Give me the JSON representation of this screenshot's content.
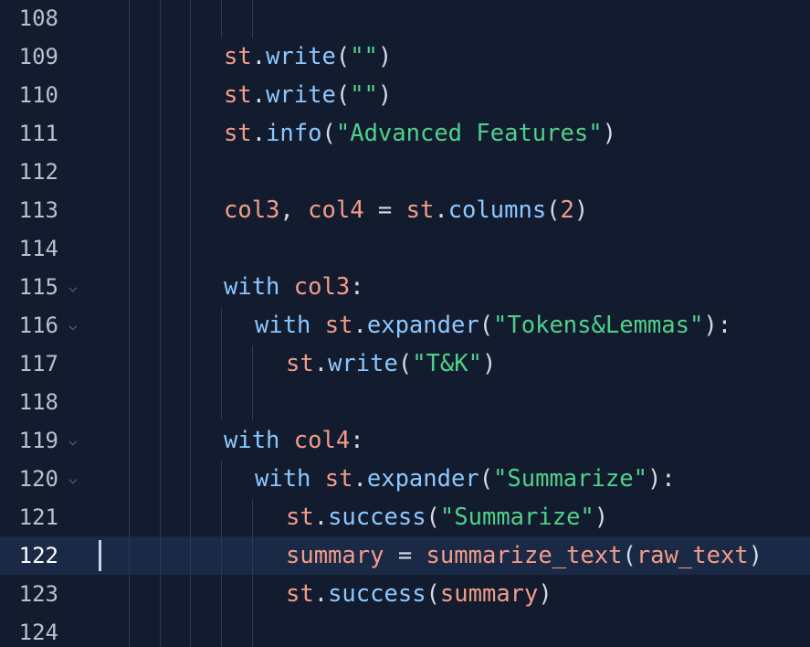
{
  "editor": {
    "lines": [
      {
        "num": "108",
        "fold": false,
        "active": false,
        "indent": 0,
        "tokens": []
      },
      {
        "num": "109",
        "fold": false,
        "active": false,
        "indent": 1,
        "tokens": [
          {
            "t": "st",
            "c": "var"
          },
          {
            "t": ".",
            "c": "op"
          },
          {
            "t": "write",
            "c": "fn"
          },
          {
            "t": "(",
            "c": "op"
          },
          {
            "t": "\"\"",
            "c": "str"
          },
          {
            "t": ")",
            "c": "op"
          }
        ]
      },
      {
        "num": "110",
        "fold": false,
        "active": false,
        "indent": 1,
        "tokens": [
          {
            "t": "st",
            "c": "var"
          },
          {
            "t": ".",
            "c": "op"
          },
          {
            "t": "write",
            "c": "fn"
          },
          {
            "t": "(",
            "c": "op"
          },
          {
            "t": "\"\"",
            "c": "str"
          },
          {
            "t": ")",
            "c": "op"
          }
        ]
      },
      {
        "num": "111",
        "fold": false,
        "active": false,
        "indent": 1,
        "tokens": [
          {
            "t": "st",
            "c": "var"
          },
          {
            "t": ".",
            "c": "op"
          },
          {
            "t": "info",
            "c": "fn"
          },
          {
            "t": "(",
            "c": "op"
          },
          {
            "t": "\"Advanced Features\"",
            "c": "str"
          },
          {
            "t": ")",
            "c": "op"
          }
        ]
      },
      {
        "num": "112",
        "fold": false,
        "active": false,
        "indent": 0,
        "tokens": []
      },
      {
        "num": "113",
        "fold": false,
        "active": false,
        "indent": 1,
        "tokens": [
          {
            "t": "col3",
            "c": "var"
          },
          {
            "t": ", ",
            "c": "op"
          },
          {
            "t": "col4",
            "c": "var"
          },
          {
            "t": " = ",
            "c": "op"
          },
          {
            "t": "st",
            "c": "var"
          },
          {
            "t": ".",
            "c": "op"
          },
          {
            "t": "columns",
            "c": "fn"
          },
          {
            "t": "(",
            "c": "op"
          },
          {
            "t": "2",
            "c": "num"
          },
          {
            "t": ")",
            "c": "op"
          }
        ]
      },
      {
        "num": "114",
        "fold": false,
        "active": false,
        "indent": 0,
        "tokens": []
      },
      {
        "num": "115",
        "fold": true,
        "active": false,
        "indent": 1,
        "tokens": [
          {
            "t": "with",
            "c": "kw"
          },
          {
            "t": " ",
            "c": "op"
          },
          {
            "t": "col3",
            "c": "var"
          },
          {
            "t": ":",
            "c": "op"
          }
        ]
      },
      {
        "num": "116",
        "fold": true,
        "active": false,
        "indent": 2,
        "tokens": [
          {
            "t": "with",
            "c": "kw"
          },
          {
            "t": " ",
            "c": "op"
          },
          {
            "t": "st",
            "c": "var"
          },
          {
            "t": ".",
            "c": "op"
          },
          {
            "t": "expander",
            "c": "fn"
          },
          {
            "t": "(",
            "c": "op"
          },
          {
            "t": "\"Tokens&Lemmas\"",
            "c": "str"
          },
          {
            "t": "):",
            "c": "op"
          }
        ]
      },
      {
        "num": "117",
        "fold": false,
        "active": false,
        "indent": 3,
        "tokens": [
          {
            "t": "st",
            "c": "var"
          },
          {
            "t": ".",
            "c": "op"
          },
          {
            "t": "write",
            "c": "fn"
          },
          {
            "t": "(",
            "c": "op"
          },
          {
            "t": "\"T&K\"",
            "c": "str"
          },
          {
            "t": ")",
            "c": "op"
          }
        ]
      },
      {
        "num": "118",
        "fold": false,
        "active": false,
        "indent": 0,
        "tokens": []
      },
      {
        "num": "119",
        "fold": true,
        "active": false,
        "indent": 1,
        "tokens": [
          {
            "t": "with",
            "c": "kw"
          },
          {
            "t": " ",
            "c": "op"
          },
          {
            "t": "col4",
            "c": "var"
          },
          {
            "t": ":",
            "c": "op"
          }
        ]
      },
      {
        "num": "120",
        "fold": true,
        "active": false,
        "indent": 2,
        "tokens": [
          {
            "t": "with",
            "c": "kw"
          },
          {
            "t": " ",
            "c": "op"
          },
          {
            "t": "st",
            "c": "var"
          },
          {
            "t": ".",
            "c": "op"
          },
          {
            "t": "expander",
            "c": "fn"
          },
          {
            "t": "(",
            "c": "op"
          },
          {
            "t": "\"Summarize\"",
            "c": "str"
          },
          {
            "t": "):",
            "c": "op"
          }
        ]
      },
      {
        "num": "121",
        "fold": false,
        "active": false,
        "indent": 3,
        "tokens": [
          {
            "t": "st",
            "c": "var"
          },
          {
            "t": ".",
            "c": "op"
          },
          {
            "t": "success",
            "c": "fn"
          },
          {
            "t": "(",
            "c": "op"
          },
          {
            "t": "\"Summarize\"",
            "c": "str"
          },
          {
            "t": ")",
            "c": "op"
          }
        ]
      },
      {
        "num": "122",
        "fold": false,
        "active": true,
        "indent": 3,
        "tokens": [
          {
            "t": "summary",
            "c": "var"
          },
          {
            "t": " = ",
            "c": "op"
          },
          {
            "t": "summarize_text",
            "c": "var"
          },
          {
            "t": "(",
            "c": "op"
          },
          {
            "t": "raw_text",
            "c": "var"
          },
          {
            "t": ")",
            "c": "op"
          }
        ]
      },
      {
        "num": "123",
        "fold": false,
        "active": false,
        "indent": 3,
        "tokens": [
          {
            "t": "st",
            "c": "var"
          },
          {
            "t": ".",
            "c": "op"
          },
          {
            "t": "success",
            "c": "fn"
          },
          {
            "t": "(",
            "c": "op"
          },
          {
            "t": "summary",
            "c": "var"
          },
          {
            "t": ")",
            "c": "op"
          }
        ]
      },
      {
        "num": "124",
        "fold": false,
        "active": false,
        "indent": 0,
        "tokens": []
      }
    ],
    "fold_glyph": "⌵",
    "colors": {
      "background": "#131b2e",
      "active_line": "#1a2945",
      "variable": "#f29d8a",
      "function": "#8cc8ff",
      "string": "#4fd18a",
      "keyword": "#8cc8ff"
    }
  }
}
